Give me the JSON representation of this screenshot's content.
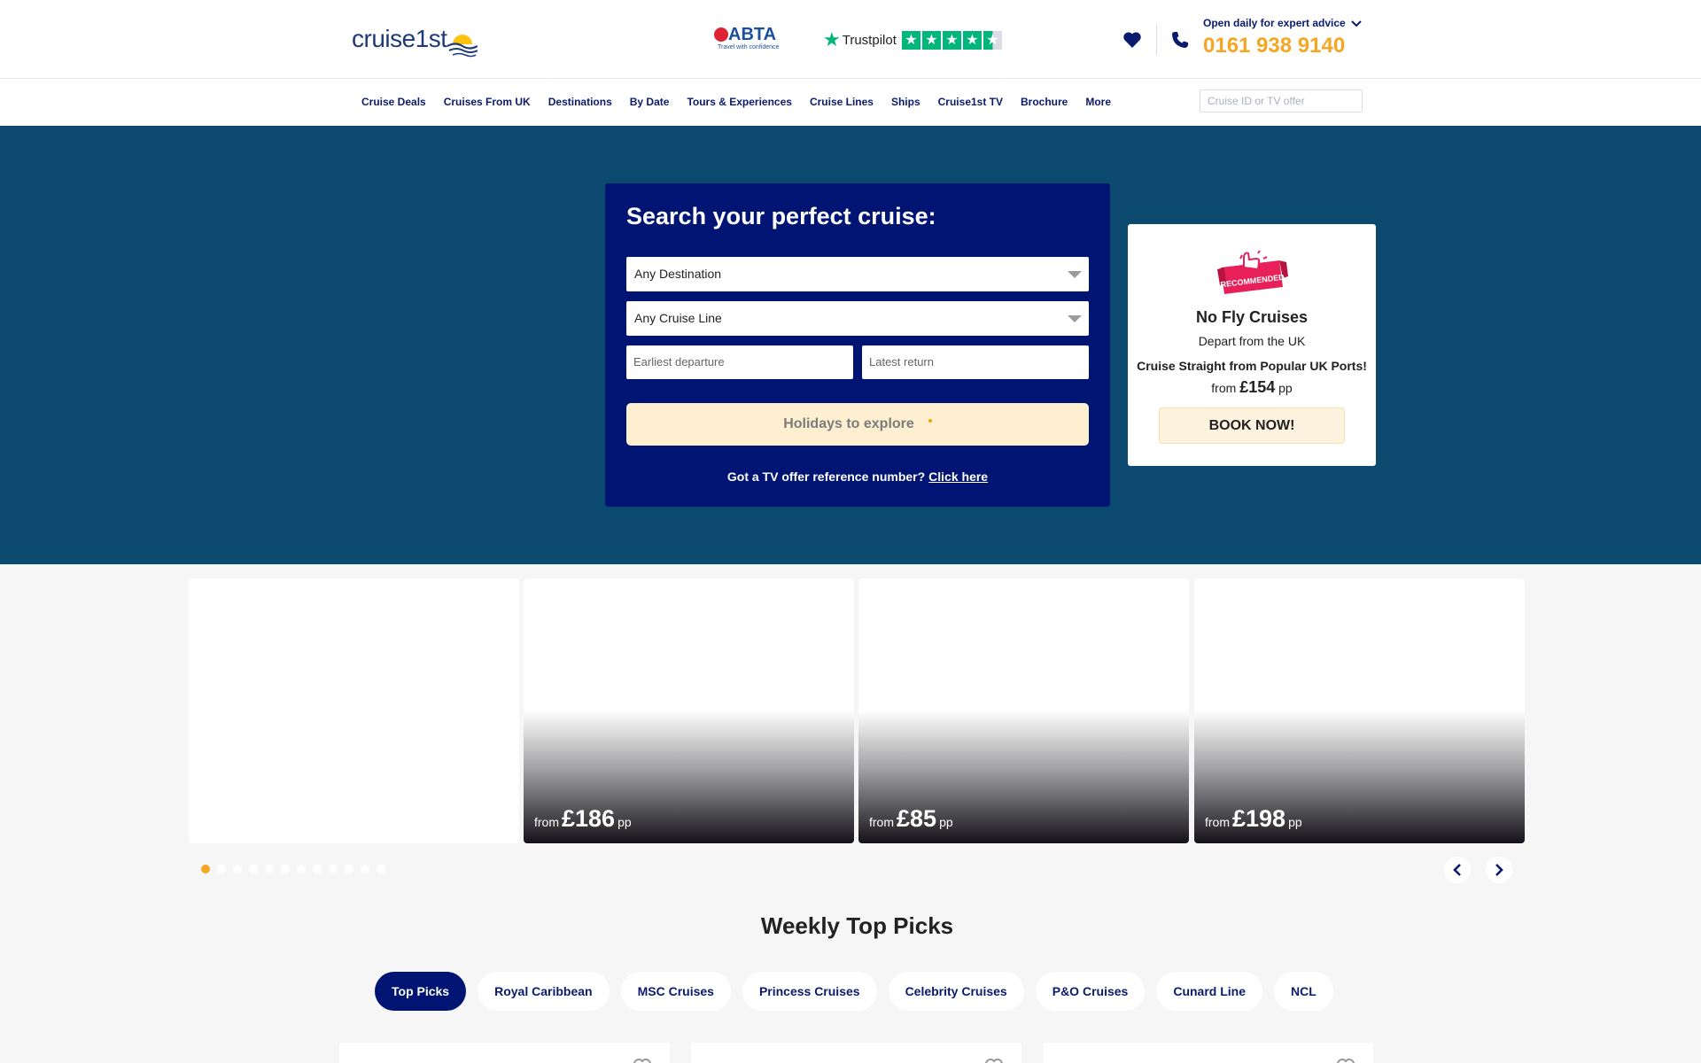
{
  "header": {
    "logo_text": "cruise1st",
    "abta": {
      "name": "ABTA",
      "tagline": "Travel with confidence"
    },
    "trustpilot": {
      "name": "Trustpilot",
      "stars": 4.5
    },
    "advice_text": "Open daily for expert advice",
    "phone": "0161 938 9140"
  },
  "nav": {
    "items": [
      "Cruise Deals",
      "Cruises From UK",
      "Destinations",
      "By Date",
      "Tours & Experiences",
      "Cruise Lines",
      "Ships",
      "Cruise1st TV",
      "Brochure",
      "More"
    ],
    "search_placeholder": "Cruise ID or TV offer"
  },
  "search": {
    "title": "Search your perfect cruise:",
    "destination": "Any Destination",
    "cruise_line": "Any Cruise Line",
    "earliest_placeholder": "Earliest departure",
    "latest_placeholder": "Latest return",
    "explore_label": "Holidays to explore",
    "tv_text": "Got a TV offer reference number?",
    "tv_link": "Click here"
  },
  "promo": {
    "badge": "RECOMMENDED",
    "title": "No Fly Cruises",
    "subtitle": "Depart from the UK",
    "strapline": "Cruise Straight from Popular UK Ports!",
    "price_from": "from",
    "price": "£154",
    "price_unit": "pp",
    "cta": "BOOK NOW!"
  },
  "carousel": {
    "cards": [
      {
        "from": "",
        "price": "",
        "unit": ""
      },
      {
        "from": "from",
        "price": "£186",
        "unit": "pp"
      },
      {
        "from": "from",
        "price": "£85",
        "unit": "pp"
      },
      {
        "from": "from",
        "price": "£198",
        "unit": "pp"
      }
    ],
    "dot_count": 12,
    "active_dot": 0
  },
  "weekly": {
    "title": "Weekly Top Picks",
    "tabs": [
      "Top Picks",
      "Royal Caribbean",
      "MSC Cruises",
      "Princess Cruises",
      "Celebrity Cruises",
      "P&O Cruises",
      "Cunard Line",
      "NCL"
    ],
    "active_tab": 0
  },
  "colors": {
    "navy": "#001473",
    "hero": "#0b4a6e",
    "accent": "#f5a623",
    "trustpilot": "#00b67a"
  }
}
